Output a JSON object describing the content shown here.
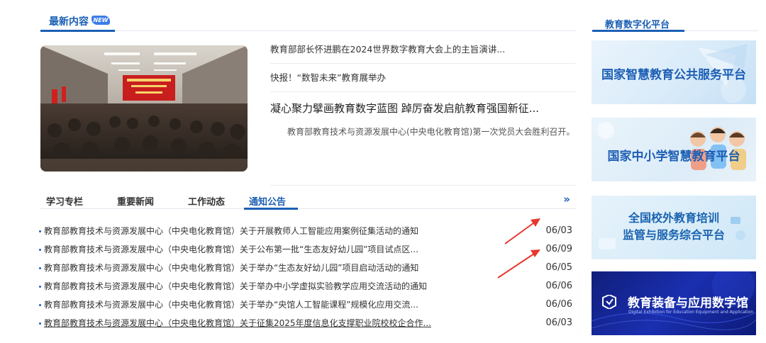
{
  "latest": {
    "title": "最新内容",
    "badge": "NEW"
  },
  "top_news": [
    "教育部部长怀进鹏在2024世界数字教育大会上的主旨演讲...",
    "快报！“数智未来”教育展举办"
  ],
  "featured": {
    "title": "凝心聚力擘画教育数字蓝图 踔厉奋发启航教育强国新征...",
    "desc": "教育部教育技术与资源发展中心(中央电化教育馆)第一次党员大会胜利召开。"
  },
  "tabs": [
    {
      "label": "学习专栏",
      "active": false
    },
    {
      "label": "重要新闻",
      "active": false
    },
    {
      "label": "工作动态",
      "active": false
    },
    {
      "label": "通知公告",
      "active": true
    }
  ],
  "more_label": "»",
  "notices": [
    {
      "title": "教育部教育技术与资源发展中心（中央电化教育馆）关于开展教师人工智能应用案例征集活动的通知",
      "date": "06/03"
    },
    {
      "title": "教育部教育技术与资源发展中心（中央电化教育馆）关于公布第一批“生态友好幼儿园”项目试点区...",
      "date": "06/09"
    },
    {
      "title": "教育部教育技术与资源发展中心（中央电化教育馆）关于举办“生态友好幼儿园”项目启动活动的通知",
      "date": "06/05"
    },
    {
      "title": "教育部教育技术与资源发展中心（中央电化教育馆）关于举办中小学虚拟实验教学应用交流活动的通知",
      "date": "06/06"
    },
    {
      "title": "教育部教育技术与资源发展中心（中央电化教育馆）关于举办“央馆人工智能课程”规模化应用交流...",
      "date": "06/06"
    },
    {
      "title": "教育部教育技术与资源发展中心（中央电化教育馆）关于征集2025年度信息化支撑职业院校校企合作...",
      "date": "06/03"
    }
  ],
  "side": {
    "title": "教育数字化平台",
    "platforms": [
      {
        "name": "国家智慧教育公共服务平台"
      },
      {
        "name": "国家中小学智慧教育平台"
      },
      {
        "name_line1": "全国校外教育培训",
        "name_line2": "监管与服务综合平台"
      },
      {
        "name": "教育装备与应用数字馆",
        "sub": "Digital Exhibition for Education Equipment and Application"
      }
    ]
  },
  "colors": {
    "accent": "#1b5fb4",
    "arrow": "#e8362d"
  }
}
